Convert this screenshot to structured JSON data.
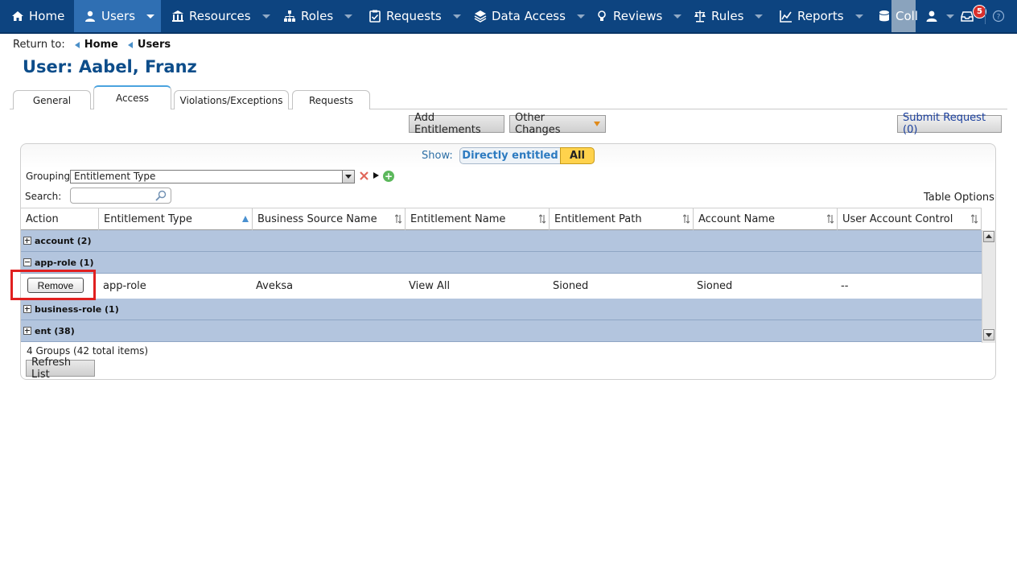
{
  "nav": {
    "items": [
      {
        "label": "Home",
        "icon": "home-icon"
      },
      {
        "label": "Users",
        "icon": "user-icon",
        "active": true
      },
      {
        "label": "Resources",
        "icon": "building-icon"
      },
      {
        "label": "Roles",
        "icon": "hierarchy-icon"
      },
      {
        "label": "Requests",
        "icon": "clipboard-check-icon"
      },
      {
        "label": "Data Access",
        "icon": "layers-icon"
      },
      {
        "label": "Reviews",
        "icon": "lightbulb-icon"
      },
      {
        "label": "Rules",
        "icon": "scales-icon"
      },
      {
        "label": "Reports",
        "icon": "chart-icon"
      },
      {
        "label": "Coll",
        "icon": "database-icon"
      }
    ],
    "notification_count": "5",
    "colors": {
      "bar": "#0d4480",
      "active": "#2f6fb3",
      "badge": "#d9302c"
    }
  },
  "breadcrumb": {
    "label": "Return to:",
    "links": [
      "Home",
      "Users"
    ]
  },
  "page": {
    "title": "User: Aabel, Franz"
  },
  "tabs": [
    {
      "label": "General"
    },
    {
      "label": "Access",
      "active": true
    },
    {
      "label": "Violations/Exceptions"
    },
    {
      "label": "Requests"
    }
  ],
  "toolbar": {
    "add_entitlements": "Add Entitlements",
    "other_changes": "Other Changes",
    "submit_request": "Submit Request (0)"
  },
  "filters": {
    "show_label": "Show:",
    "show_options": [
      "Directly entitled",
      "All"
    ],
    "show_selected": "All",
    "grouping_label": "Grouping:",
    "grouping_value": "Entitlement Type",
    "search_label": "Search:",
    "search_value": "",
    "table_options": "Table Options"
  },
  "grid": {
    "columns": [
      "Action",
      "Entitlement Type",
      "Business Source Name",
      "Entitlement Name",
      "Entitlement Path",
      "Account Name",
      "User Account Control"
    ],
    "groups": [
      {
        "label": "account (2)",
        "expanded": false
      },
      {
        "label": "app-role (1)",
        "expanded": true
      },
      {
        "label": "business-role (1)",
        "expanded": false
      },
      {
        "label": "ent (38)",
        "expanded": false
      }
    ],
    "rows": [
      {
        "action": "Remove",
        "entitlement_type": "app-role",
        "business_source_name": "Aveksa",
        "entitlement_name": "View All",
        "entitlement_path": "Sioned",
        "account_name": "Sioned",
        "user_account_control": "--"
      }
    ],
    "summary": "4 Groups (42 total items)",
    "refresh": "Refresh List"
  }
}
